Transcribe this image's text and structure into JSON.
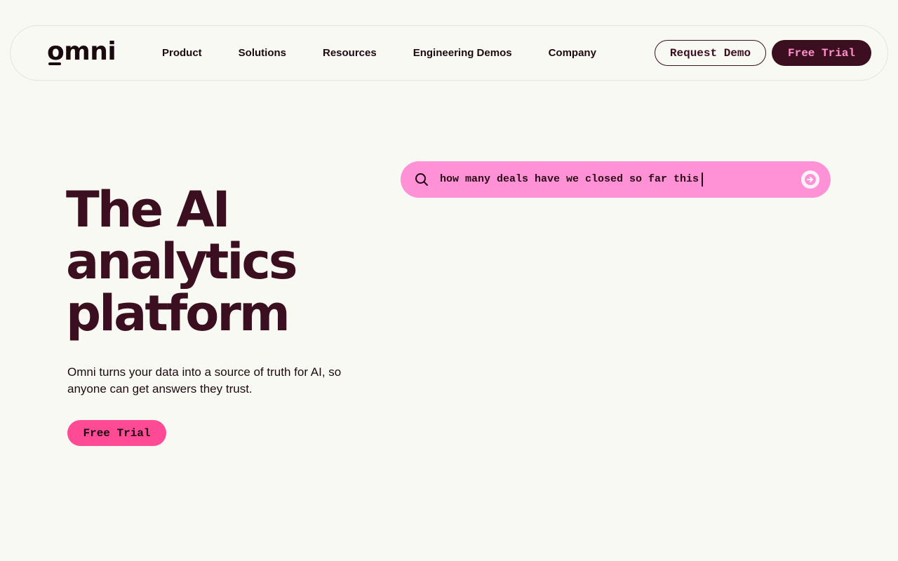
{
  "nav": {
    "logo": "omni",
    "links": [
      "Product",
      "Solutions",
      "Resources",
      "Engineering Demos",
      "Company"
    ],
    "request_demo": "Request Demo",
    "free_trial": "Free Trial"
  },
  "hero": {
    "title_lines": [
      "The AI",
      "analytics",
      "platform"
    ],
    "subtitle": "Omni turns your data into a source of truth for AI, so anyone can get answers they trust.",
    "cta": "Free Trial"
  },
  "search": {
    "query": "how many deals have we closed so far this",
    "icon": "search-icon",
    "submit_icon": "arrow-right-icon"
  },
  "colors": {
    "background": "#f9f9f4",
    "brand_dark": "#3c0f20",
    "brand_pink": "#ff4b96",
    "search_pink": "#ff91d6",
    "trial_text": "#ff91c8"
  }
}
